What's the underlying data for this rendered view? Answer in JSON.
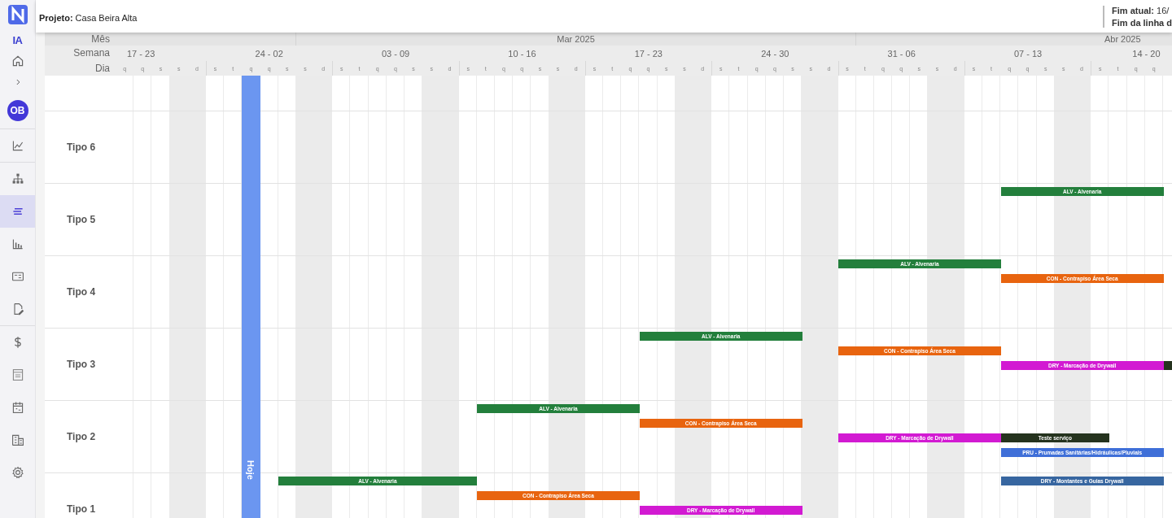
{
  "sidebar": {
    "items": [
      {
        "kind": "logo"
      },
      {
        "kind": "ai",
        "label": "IA"
      },
      {
        "kind": "icon",
        "selected": false
      },
      {
        "kind": "icon",
        "selected": false
      },
      {
        "kind": "avatar",
        "label": "OB"
      },
      {
        "kind": "divider"
      },
      {
        "kind": "icon",
        "selected": false
      },
      {
        "kind": "divider"
      },
      {
        "kind": "icon",
        "selected": false
      },
      {
        "kind": "icon",
        "selected": true
      },
      {
        "kind": "icon",
        "selected": false
      },
      {
        "kind": "icon",
        "selected": false
      },
      {
        "kind": "icon",
        "selected": false
      },
      {
        "kind": "divider"
      },
      {
        "kind": "icon",
        "selected": false
      },
      {
        "kind": "icon",
        "selected": false
      },
      {
        "kind": "icon",
        "selected": false
      },
      {
        "kind": "icon",
        "selected": false
      },
      {
        "kind": "icon",
        "selected": false
      }
    ]
  },
  "header": {
    "project": "**Projeto:** Casa Beira Alta",
    "info": [
      "**Fim atual:** 16/",
      "Fim da linha d"
    ]
  },
  "timeline": {
    "row_labels": [
      "Mês",
      "Semana",
      "Dia"
    ],
    "months": [
      {
        "kind": "blank"
      },
      {
        "kind": "named",
        "label": "Mar 2025"
      },
      {
        "kind": "named",
        "label": "Abr 2025"
      }
    ],
    "weeks": [
      {
        "label": "17 - 23"
      },
      {
        "label": "24 - 02"
      },
      {
        "label": "03 - 09"
      },
      {
        "label": "10 - 16"
      },
      {
        "label": "17 - 23"
      },
      {
        "label": "24 - 30"
      },
      {
        "label": "31 - 06"
      },
      {
        "label": "07 - 13"
      },
      {
        "label": "14 - 20"
      }
    ],
    "days": [
      "q",
      "q",
      "s",
      "s",
      "d",
      "s",
      "t",
      "q",
      "q",
      "s",
      "s",
      "d",
      "s",
      "t",
      "q",
      "q",
      "s",
      "s",
      "d",
      "s",
      "t",
      "q",
      "q",
      "s",
      "s",
      "d",
      "s",
      "t",
      "q",
      "q",
      "s",
      "s",
      "d",
      "s",
      "t",
      "q",
      "q",
      "s",
      "s",
      "d",
      "s",
      "t",
      "q",
      "q",
      "s",
      "s",
      "d",
      "s",
      "t",
      "q",
      "q",
      "s",
      "s",
      "d",
      "s",
      "t",
      "q",
      "q"
    ],
    "today": {
      "label": "Hoje"
    }
  },
  "rows": [
    {
      "lanes": []
    },
    {
      "label": "Tipo 6",
      "lanes": []
    },
    {
      "label": "Tipo 5",
      "lanes": [
        [
          {
            "label": "ALV - Alvenaria",
            "color": "#237f3c"
          }
        ]
      ]
    },
    {
      "label": "Tipo 4",
      "lanes": [
        [
          {
            "label": "ALV - Alvenaria",
            "color": "#237f3c"
          }
        ],
        [
          {
            "label": "CON - Contrapiso Área Seca",
            "color": "#e8640f"
          }
        ]
      ]
    },
    {
      "label": "Tipo 3",
      "lanes": [
        [
          {
            "label": "ALV - Alvenaria",
            "color": "#237f3c"
          }
        ],
        [
          {
            "label": "CON - Contrapiso Área Seca",
            "color": "#e8640f"
          }
        ],
        [
          {
            "label": "DRY - Marcação de Drywall",
            "color": "#d21ad2"
          },
          {
            "color": "#25331e"
          }
        ]
      ]
    },
    {
      "label": "Tipo 2",
      "lanes": [
        [
          {
            "label": "ALV - Alvenaria",
            "color": "#237f3c"
          }
        ],
        [
          {
            "label": "CON - Contrapiso Área Seca",
            "color": "#e8640f"
          }
        ],
        [
          {
            "label": "DRY - Marcação de Drywall",
            "color": "#d21ad2"
          },
          {
            "label": "Teste serviço",
            "color": "#25331e"
          }
        ],
        [
          {
            "label": "PRU - Prumadas Sanitárias/Hidráulicas/Pluviais",
            "color": "#3f6fd8"
          }
        ]
      ]
    },
    {
      "label": "Tipo 1",
      "lanes": [
        [
          {
            "label": "ALV - Alvenaria",
            "color": "#237f3c"
          },
          {
            "label": "DRY - Montantes e Guias Drywall",
            "color": "#3766a0"
          }
        ],
        [
          {
            "label": "CON - Contrapiso Área Seca",
            "color": "#e8640f"
          }
        ],
        [
          {
            "label": "DRY - Marcação de Drywall",
            "color": "#d21ad2"
          }
        ]
      ]
    }
  ]
}
